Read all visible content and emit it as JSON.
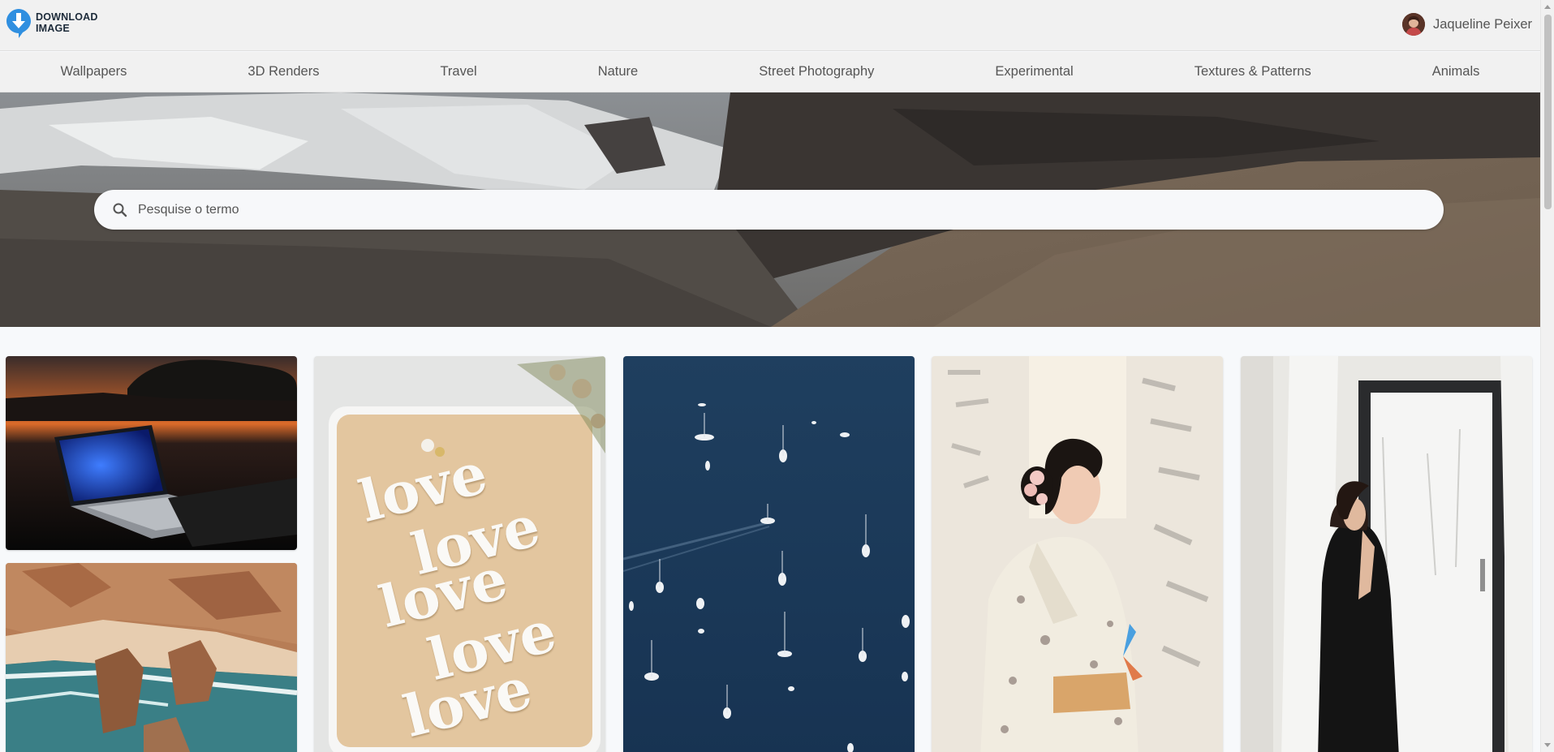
{
  "brand": {
    "line1": "DOWNLOAD",
    "line2": "IMAGE",
    "icon": "download-arrow-icon",
    "color": "#2f8fe0"
  },
  "user": {
    "name": "Jaqueline Peixer"
  },
  "categories": [
    "Wallpapers",
    "3D Renders",
    "Travel",
    "Nature",
    "Street Photography",
    "Experimental",
    "Textures & Patterns",
    "Animals"
  ],
  "search": {
    "placeholder": "Pesquise o termo",
    "value": "",
    "icon": "search-icon"
  },
  "gallery": [
    {
      "name": "laptop-sunset-photo"
    },
    {
      "name": "love-cookies-tray-photo",
      "words": [
        "love",
        "love",
        "love",
        "love",
        "love"
      ]
    },
    {
      "name": "sailboats-ocean-photo"
    },
    {
      "name": "kimono-woman-photo"
    },
    {
      "name": "woman-black-dress-window-photo"
    },
    {
      "name": "rocky-coast-beach-photo"
    }
  ]
}
